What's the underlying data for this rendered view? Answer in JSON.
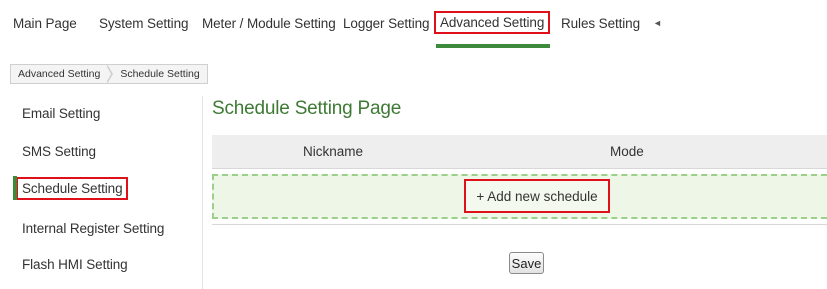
{
  "topnav": {
    "tabs": [
      {
        "label": "Main Page"
      },
      {
        "label": "System Setting"
      },
      {
        "label": "Meter / Module Setting"
      },
      {
        "label": "Logger Setting"
      },
      {
        "label": "Advanced Setting",
        "active": true
      },
      {
        "label": "Rules Setting"
      }
    ],
    "scroll_icon": "triangle-left-icon"
  },
  "breadcrumb": [
    "Advanced Setting",
    "Schedule Setting"
  ],
  "sidebar": {
    "items": [
      {
        "label": "Email Setting"
      },
      {
        "label": "SMS Setting"
      },
      {
        "label": "Schedule Setting",
        "active": true
      },
      {
        "label": "Internal Register Setting"
      },
      {
        "label": "Flash HMI Setting"
      }
    ]
  },
  "main": {
    "title": "Schedule Setting Page",
    "columns": [
      "Nickname",
      "Mode"
    ],
    "add_button": "+ Add new schedule",
    "save_button": "Save"
  },
  "colors": {
    "accent_green": "#3e8a3c",
    "title_green": "#3e7a34",
    "highlight_red": "#e0101a",
    "add_row_bg": "#eef6e8"
  }
}
